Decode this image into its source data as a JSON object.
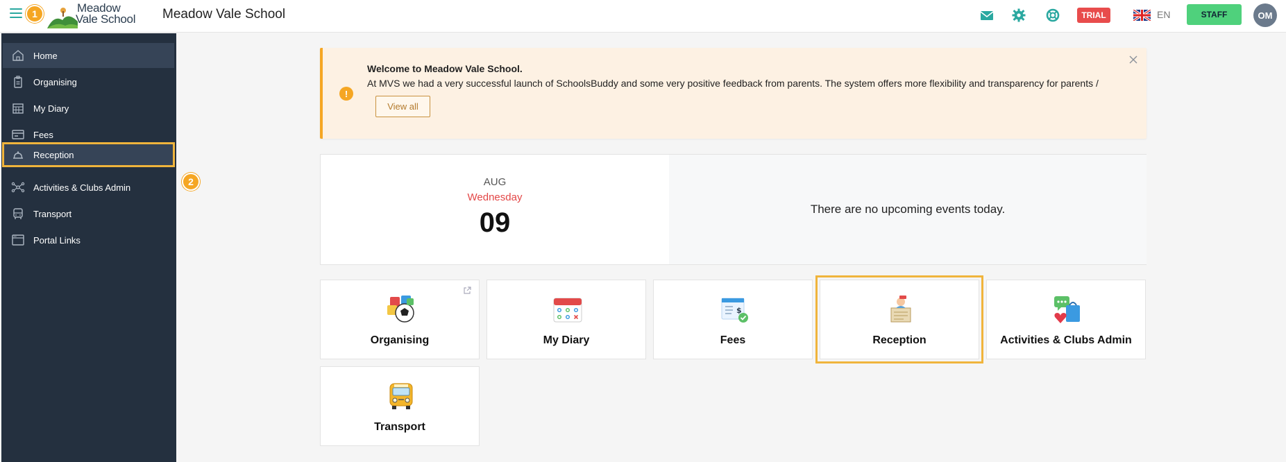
{
  "header": {
    "logo_line1": "Meadow",
    "logo_line2": "Vale School",
    "site_title": "Meadow Vale School",
    "trial_label": "TRIAL",
    "language": "EN",
    "staff_label": "STAFF",
    "avatar_initials": "OM",
    "step1": "1"
  },
  "sidebar": {
    "items": [
      {
        "label": "Home",
        "icon": "home-icon"
      },
      {
        "label": "Organising",
        "icon": "clipboard-icon"
      },
      {
        "label": "My Diary",
        "icon": "calendar-icon"
      },
      {
        "label": "Fees",
        "icon": "credit-card-icon"
      },
      {
        "label": "Reception",
        "icon": "bell-icon"
      },
      {
        "label": "Activities & Clubs Admin",
        "icon": "network-icon"
      },
      {
        "label": "Transport",
        "icon": "bus-icon"
      },
      {
        "label": "Portal Links",
        "icon": "browser-icon"
      }
    ],
    "step2": "2"
  },
  "alert": {
    "title": "Welcome to Meadow Vale School.",
    "body": "At MVS we had a very successful launch of SchoolsBuddy and some very positive feedback from parents. The system offers more flexibility and transparency for parents /",
    "button": "View all"
  },
  "date_card": {
    "month": "AUG",
    "weekday": "Wednesday",
    "day": "09",
    "events_text": "There are no upcoming events today."
  },
  "tiles": [
    {
      "label": "Organising"
    },
    {
      "label": "My Diary"
    },
    {
      "label": "Fees"
    },
    {
      "label": "Reception"
    },
    {
      "label": "Activities & Clubs Admin"
    },
    {
      "label": "Transport"
    }
  ],
  "colors": {
    "accent": "#2aa8a0",
    "sidebar_bg": "#24303f",
    "highlight": "#f0b43c",
    "trial": "#e84c4c",
    "staff": "#4fd17c"
  }
}
